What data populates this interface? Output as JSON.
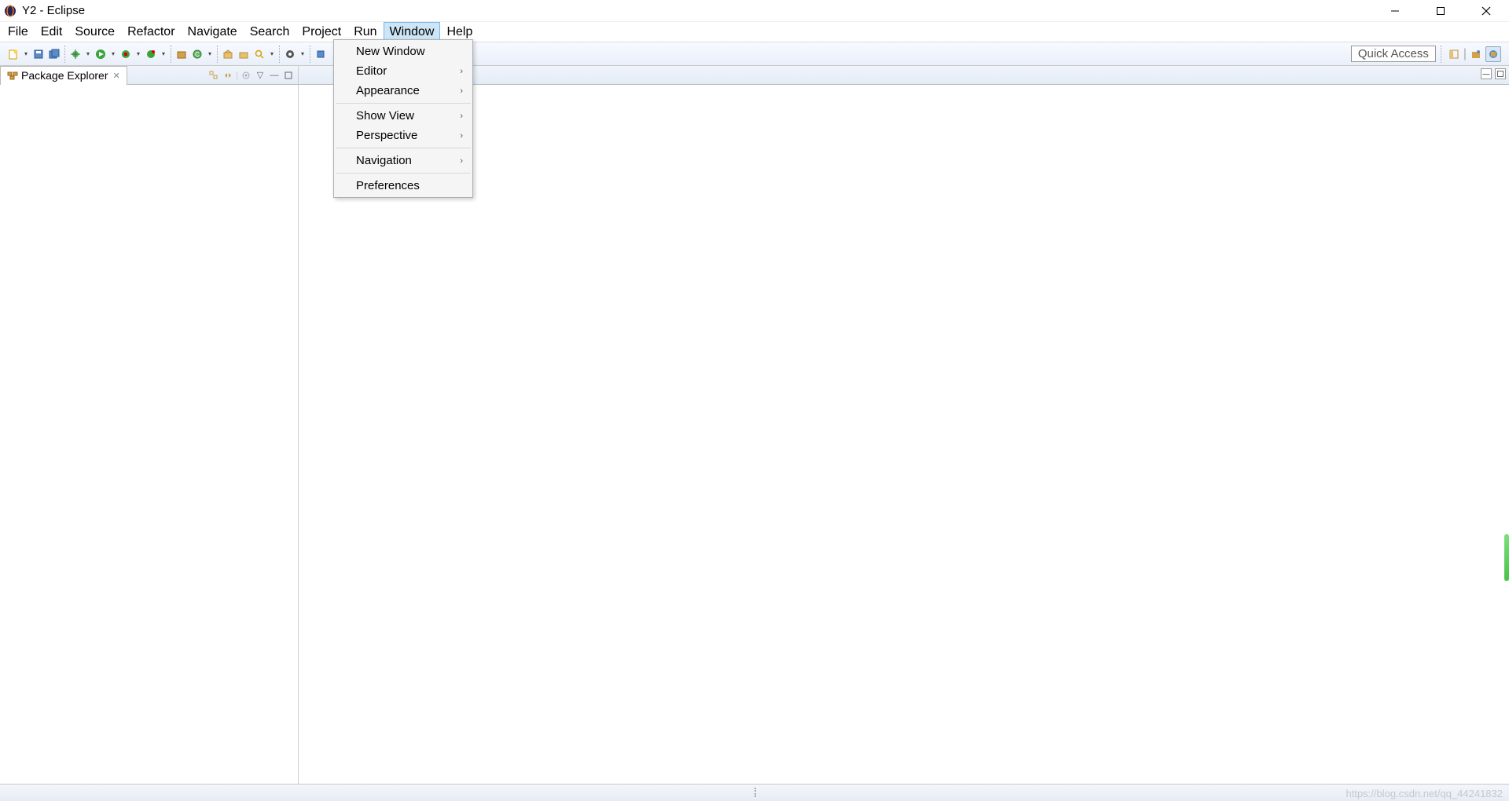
{
  "window": {
    "title": "Y2 - Eclipse"
  },
  "menubar": {
    "items": [
      "File",
      "Edit",
      "Source",
      "Refactor",
      "Navigate",
      "Search",
      "Project",
      "Run",
      "Window",
      "Help"
    ],
    "active_index": 8
  },
  "window_menu": {
    "items": [
      {
        "label": "New Window",
        "submenu": false
      },
      {
        "label": "Editor",
        "submenu": true
      },
      {
        "label": "Appearance",
        "submenu": true
      },
      {
        "sep": true
      },
      {
        "label": "Show View",
        "submenu": true
      },
      {
        "label": "Perspective",
        "submenu": true
      },
      {
        "sep": true
      },
      {
        "label": "Navigation",
        "submenu": true
      },
      {
        "sep": true
      },
      {
        "label": "Preferences",
        "submenu": false
      }
    ]
  },
  "toolbar": {
    "quick_access_placeholder": "Quick Access"
  },
  "sidebar": {
    "tab_label": "Package Explorer"
  },
  "watermark": "https://blog.csdn.net/qq_44241832"
}
